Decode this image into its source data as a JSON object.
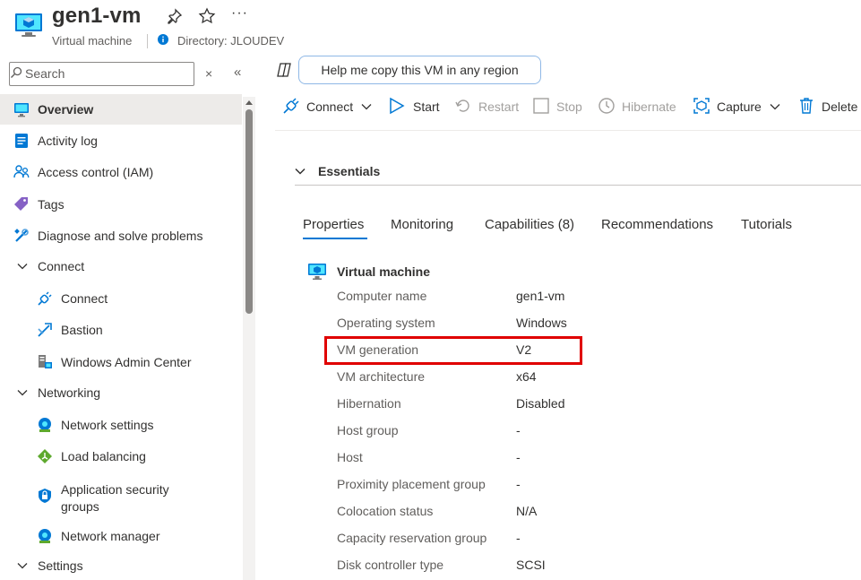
{
  "header": {
    "title": "gen1-vm",
    "subtitle": "Virtual machine",
    "directory": "Directory: JLOUDEV",
    "more": "···"
  },
  "search": {
    "placeholder": "Search",
    "close_glyph": "×",
    "collapse_glyph": "«"
  },
  "sidebar": {
    "items": [
      {
        "label": "Overview",
        "icon": "vm-icon",
        "selected": true
      },
      {
        "label": "Activity log",
        "icon": "activity-log-icon"
      },
      {
        "label": "Access control (IAM)",
        "icon": "people-icon"
      },
      {
        "label": "Tags",
        "icon": "tag-icon"
      },
      {
        "label": "Diagnose and solve problems",
        "icon": "wrench-icon"
      },
      {
        "label": "Connect",
        "group": true
      },
      {
        "label": "Connect",
        "icon": "plug-icon",
        "child": true
      },
      {
        "label": "Bastion",
        "icon": "bastion-icon",
        "child": true
      },
      {
        "label": "Windows Admin Center",
        "icon": "admin-center-icon",
        "child": true
      },
      {
        "label": "Networking",
        "group": true
      },
      {
        "label": "Network settings",
        "icon": "network-icon",
        "child": true
      },
      {
        "label": "Load balancing",
        "icon": "load-balancer-icon",
        "child": true
      },
      {
        "label": "Application security groups",
        "icon": "shield-icon",
        "child": true
      },
      {
        "label": "Network manager",
        "icon": "network-manager-icon",
        "child": true
      },
      {
        "label": "Settings",
        "group": true
      }
    ]
  },
  "copilot": {
    "label": "Help me copy this VM in any region"
  },
  "toolbar": {
    "connect": "Connect",
    "start": "Start",
    "restart": "Restart",
    "stop": "Stop",
    "hibernate": "Hibernate",
    "capture": "Capture",
    "delete": "Delete"
  },
  "essentials": {
    "label": "Essentials"
  },
  "tabs": [
    {
      "label": "Properties",
      "active": true
    },
    {
      "label": "Monitoring"
    },
    {
      "label": "Capabilities (8)"
    },
    {
      "label": "Recommendations"
    },
    {
      "label": "Tutorials"
    }
  ],
  "properties": {
    "section_title": "Virtual machine",
    "rows": [
      {
        "key": "Computer name",
        "value": "gen1-vm"
      },
      {
        "key": "Operating system",
        "value": "Windows"
      },
      {
        "key": "VM generation",
        "value": "V2",
        "highlighted": true
      },
      {
        "key": "VM architecture",
        "value": "x64"
      },
      {
        "key": "Hibernation",
        "value": "Disabled"
      },
      {
        "key": "Host group",
        "value": "-"
      },
      {
        "key": "Host",
        "value": "-"
      },
      {
        "key": "Proximity placement group",
        "value": "-"
      },
      {
        "key": "Colocation status",
        "value": "N/A"
      },
      {
        "key": "Capacity reservation group",
        "value": "-"
      },
      {
        "key": "Disk controller type",
        "value": "SCSI"
      }
    ]
  },
  "colors": {
    "accent": "#0078d4",
    "highlight_border": "#e00000",
    "selected_bg": "#edebe9"
  }
}
